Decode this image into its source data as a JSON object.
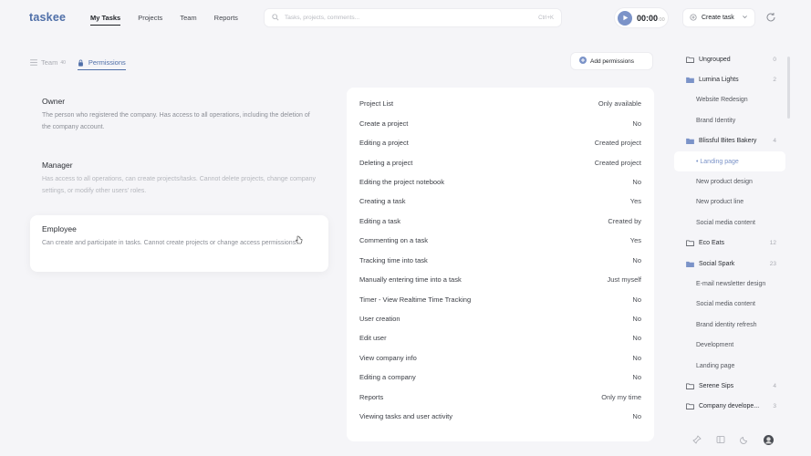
{
  "app": {
    "logo": "taskee"
  },
  "nav": [
    {
      "label": "My Tasks",
      "active": true
    },
    {
      "label": "Projects",
      "active": false
    },
    {
      "label": "Team",
      "active": false
    },
    {
      "label": "Reports",
      "active": false
    }
  ],
  "search": {
    "placeholder": "Tasks, projects, comments...",
    "shortcut": "Ctrl+K"
  },
  "timer": {
    "time": "00:00",
    "seconds": ":00"
  },
  "create_task": {
    "label": "Create task"
  },
  "tabs": {
    "team": "Team",
    "team_count": "40",
    "permissions": "Permissions"
  },
  "add_permissions": {
    "label": "Add permissions"
  },
  "roles": [
    {
      "name": "Owner",
      "description": "The person who registered the company. Has access to all operations, including the deletion of the company account."
    },
    {
      "name": "Manager",
      "description": "Has access to all operations, can create projects/tasks. Cannot delete projects, change company settings, or modify other users' roles."
    },
    {
      "name": "Employee",
      "description": "Can create and participate in tasks. Cannot create projects or change access permissions."
    }
  ],
  "permissions": [
    {
      "name": "Project List",
      "value": "Only available"
    },
    {
      "name": "Create a project",
      "value": "No"
    },
    {
      "name": "Editing a project",
      "value": "Created project"
    },
    {
      "name": "Deleting a project",
      "value": "Created project"
    },
    {
      "name": "Editing the project notebook",
      "value": "No"
    },
    {
      "name": "Creating a task",
      "value": "Yes"
    },
    {
      "name": "Editing a task",
      "value": "Created by"
    },
    {
      "name": "Commenting on a task",
      "value": "Yes"
    },
    {
      "name": "Tracking time into task",
      "value": "No"
    },
    {
      "name": "Manually entering time into a task",
      "value": "Just myself"
    },
    {
      "name": "Timer - View Realtime Time Tracking",
      "value": "No"
    },
    {
      "name": "User creation",
      "value": "No"
    },
    {
      "name": "Edit user",
      "value": "No"
    },
    {
      "name": "View company info",
      "value": "No"
    },
    {
      "name": "Editing a company",
      "value": "No"
    },
    {
      "name": "Reports",
      "value": "Only my time"
    },
    {
      "name": "Viewing tasks and user activity",
      "value": "No"
    }
  ],
  "sidebar": [
    {
      "label": "Ungrouped",
      "count": "0",
      "type": "folder-outline"
    },
    {
      "label": "Lumina Lights",
      "count": "2",
      "type": "folder-filled"
    },
    {
      "label": "Website Redesign",
      "count": "",
      "type": "sub"
    },
    {
      "label": "Brand Identity",
      "count": "",
      "type": "sub"
    },
    {
      "label": "Blissful Bites Bakery",
      "count": "4",
      "type": "folder-filled"
    },
    {
      "label": "• Landing page",
      "count": "",
      "type": "sub-active"
    },
    {
      "label": "New product design",
      "count": "",
      "type": "sub"
    },
    {
      "label": "New product line",
      "count": "",
      "type": "sub"
    },
    {
      "label": "Social media content",
      "count": "",
      "type": "sub"
    },
    {
      "label": "Eco Eats",
      "count": "12",
      "type": "folder-outline"
    },
    {
      "label": "Social Spark",
      "count": "23",
      "type": "folder-filled"
    },
    {
      "label": "E-mail newsletter design",
      "count": "",
      "type": "sub"
    },
    {
      "label": "Social media content",
      "count": "",
      "type": "sub"
    },
    {
      "label": "Brand identity refresh",
      "count": "",
      "type": "sub"
    },
    {
      "label": "Development",
      "count": "",
      "type": "sub"
    },
    {
      "label": "Landing page",
      "count": "",
      "type": "sub"
    },
    {
      "label": "Serene Sips",
      "count": "4",
      "type": "folder-outline"
    },
    {
      "label": "Company develope...",
      "count": "3",
      "type": "folder-outline"
    }
  ],
  "colors": {
    "accent": "#4f6fa8",
    "folder": "#7b93c8"
  }
}
